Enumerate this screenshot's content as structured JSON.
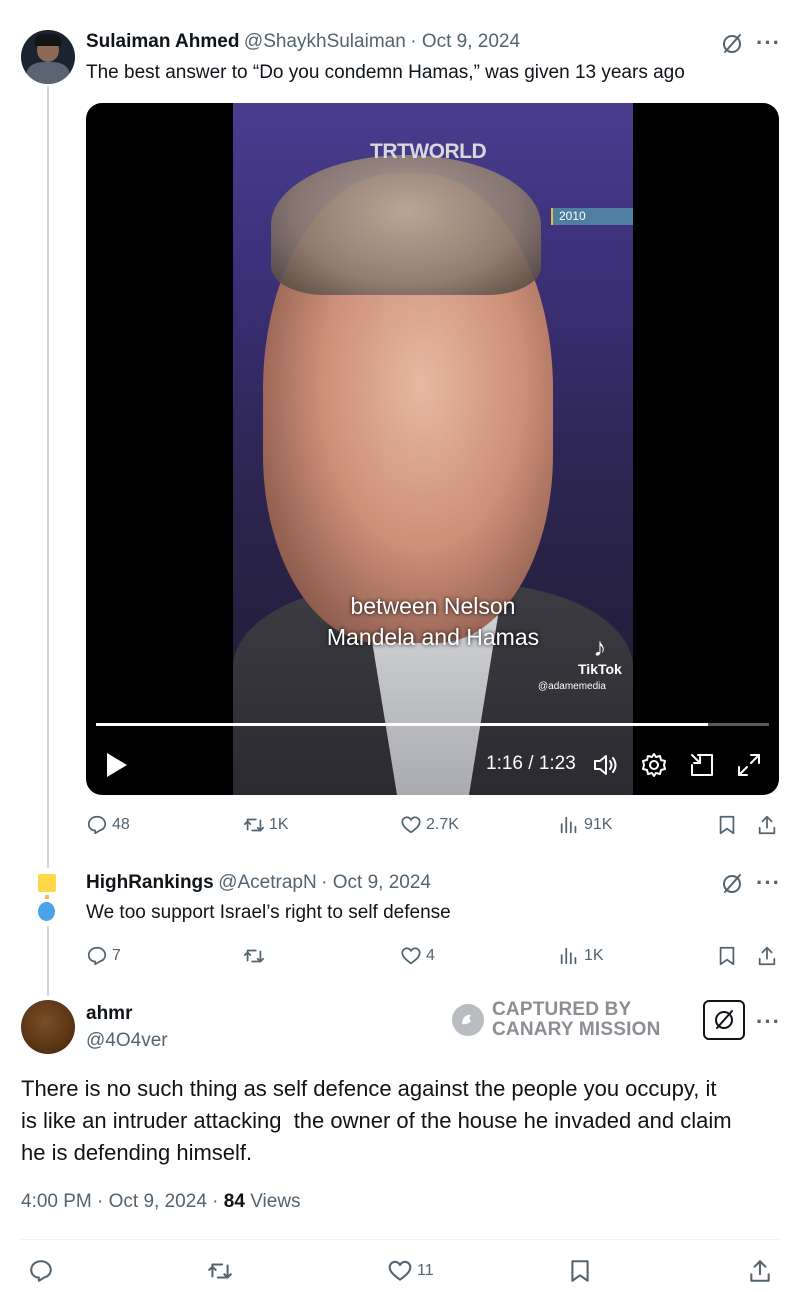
{
  "tweet1": {
    "name": "Sulaiman Ahmed",
    "handle": "@ShaykhSulaiman",
    "date": "· Oct 9, 2024",
    "text": "The best answer to “Do you condemn Hamas,” was given 13 years ago",
    "video": {
      "channel": "TRTWORLD",
      "year_tag": "2010",
      "caption_line1": "between Nelson",
      "caption_line2": "Mandela and Hamas",
      "watermark": "TikTok",
      "watermark_handle": "@adamemedia",
      "time": "1:16 / 1:23",
      "progress": 0.91
    },
    "stats": {
      "replies": "48",
      "reposts": "1K",
      "likes": "2.7K",
      "views": "91K"
    }
  },
  "tweet2": {
    "name": "HighRankings",
    "handle": "@AcetrapN",
    "date": "· Oct 9, 2024",
    "text": "We too support Israel’s right to self defense",
    "stats": {
      "replies": "7",
      "reposts": "",
      "likes": "4",
      "views": "1K"
    }
  },
  "tweet3": {
    "name": "ahmr",
    "handle": "@4O4ver",
    "text_line1": "There is no such thing as self defence against the people you occupy, it",
    "text_line2": "is like an intruder attacking  the owner of the house he invaded and claim",
    "text_line3": "he is defending himself.",
    "time": "4:00 PM",
    "date": "Oct 9, 2024",
    "views_count": "84",
    "views_label": "Views",
    "stats": {
      "likes": "11"
    }
  },
  "watermark": {
    "line1": "CAPTURED BY",
    "line2": "CANARY MISSION"
  },
  "icons": {
    "grok": "slashed-circle-icon",
    "more": "more-icon",
    "reply": "reply-icon",
    "repost": "repost-icon",
    "like": "like-icon",
    "views": "views-icon",
    "bookmark": "bookmark-icon",
    "share": "share-icon"
  }
}
